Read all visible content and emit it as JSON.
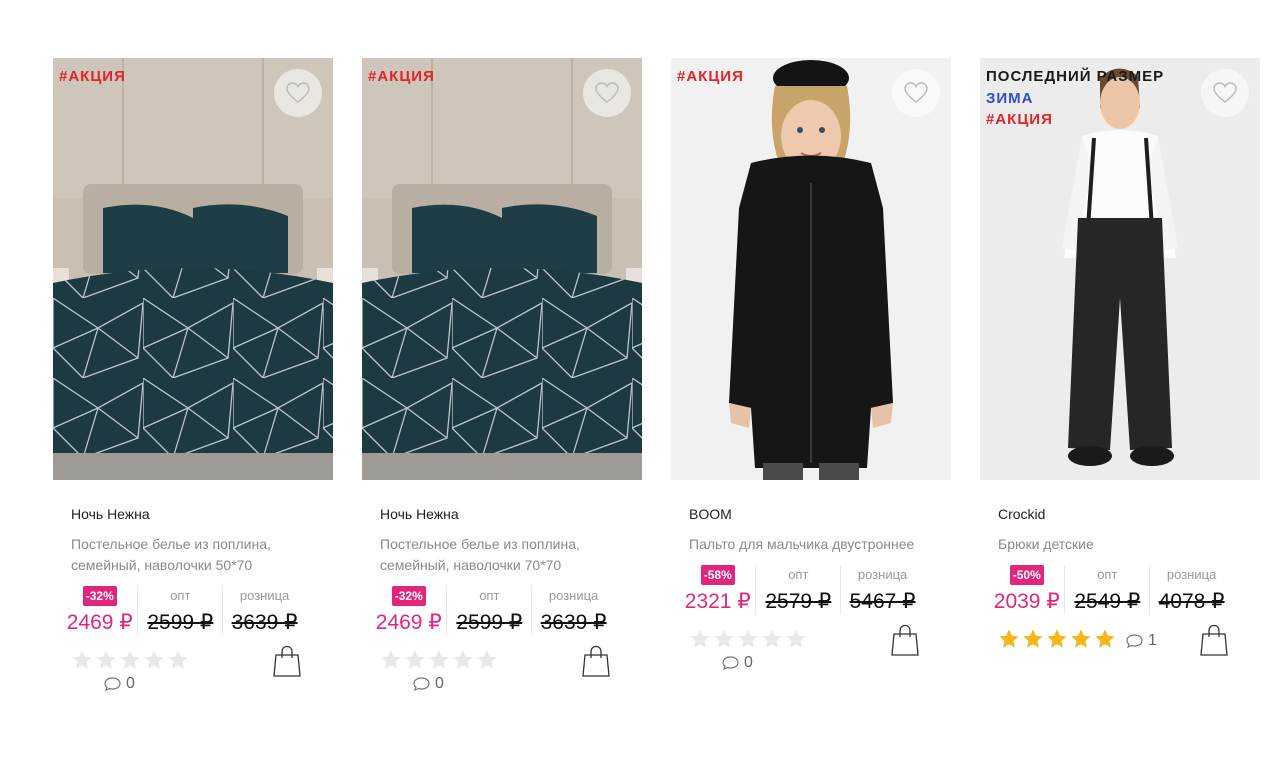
{
  "currency": "₽",
  "labels": {
    "opt": "опт",
    "retail": "розница"
  },
  "colors": {
    "accent_pink": "#e3267d",
    "promo_red": "#e3242b",
    "season_blue": "#2a4fd6",
    "star_gold": "#f5b71a",
    "star_empty": "#e8e8e8"
  },
  "products": [
    {
      "tags": [
        {
          "text": "#АКЦИЯ",
          "kind": "promo"
        }
      ],
      "image": "bedding-set-teal-geometric",
      "brand": "Ночь Нежна",
      "description": "Постельное белье из поплина, семейный, наволочки 50*70",
      "discount": "-32%",
      "price_sale": "2469 ₽",
      "price_opt": "2599 ₽",
      "price_retail": "3639 ₽",
      "rating": 0,
      "comments": "0"
    },
    {
      "tags": [
        {
          "text": "#АКЦИЯ",
          "kind": "promo"
        }
      ],
      "image": "bedding-set-teal-geometric",
      "brand": "Ночь Нежна",
      "description": "Постельное белье из поплина, семейный, наволочки 70*70",
      "discount": "-32%",
      "price_sale": "2469 ₽",
      "price_opt": "2599 ₽",
      "price_retail": "3639 ₽",
      "rating": 0,
      "comments": "0"
    },
    {
      "tags": [
        {
          "text": "#АКЦИЯ",
          "kind": "promo"
        }
      ],
      "image": "boy-black-coat",
      "brand": "BOOM",
      "description": "Пальто для мальчика двустроннее",
      "discount": "-58%",
      "price_sale": "2321 ₽",
      "price_opt": "2579 ₽",
      "price_retail": "5467 ₽",
      "rating": 0,
      "comments": "0"
    },
    {
      "tags": [
        {
          "text": "ПОСЛЕДНИЙ РАЗМЕР",
          "kind": "last"
        },
        {
          "text": "ЗИМА",
          "kind": "season"
        },
        {
          "text": "#АКЦИЯ",
          "kind": "promo"
        }
      ],
      "image": "boy-black-snow-pants",
      "brand": "Crockid",
      "description": "Брюки детские",
      "discount": "-50%",
      "price_sale": "2039 ₽",
      "price_opt": "2549 ₽",
      "price_retail": "4078 ₽",
      "rating": 5,
      "comments": "1"
    }
  ]
}
